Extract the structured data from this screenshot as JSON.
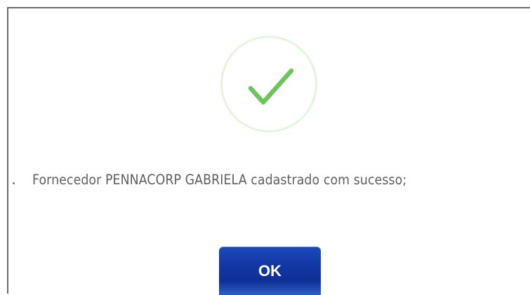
{
  "dialog": {
    "icon": "checkmark-circle-icon",
    "icon_color": "#6cc45a",
    "icon_ring_color": "#e6f3df",
    "message": "Fornecedor PENNACORP GABRIELA cadastrado com sucesso;",
    "ok_label": "OK",
    "ok_color": "#1236a3"
  }
}
